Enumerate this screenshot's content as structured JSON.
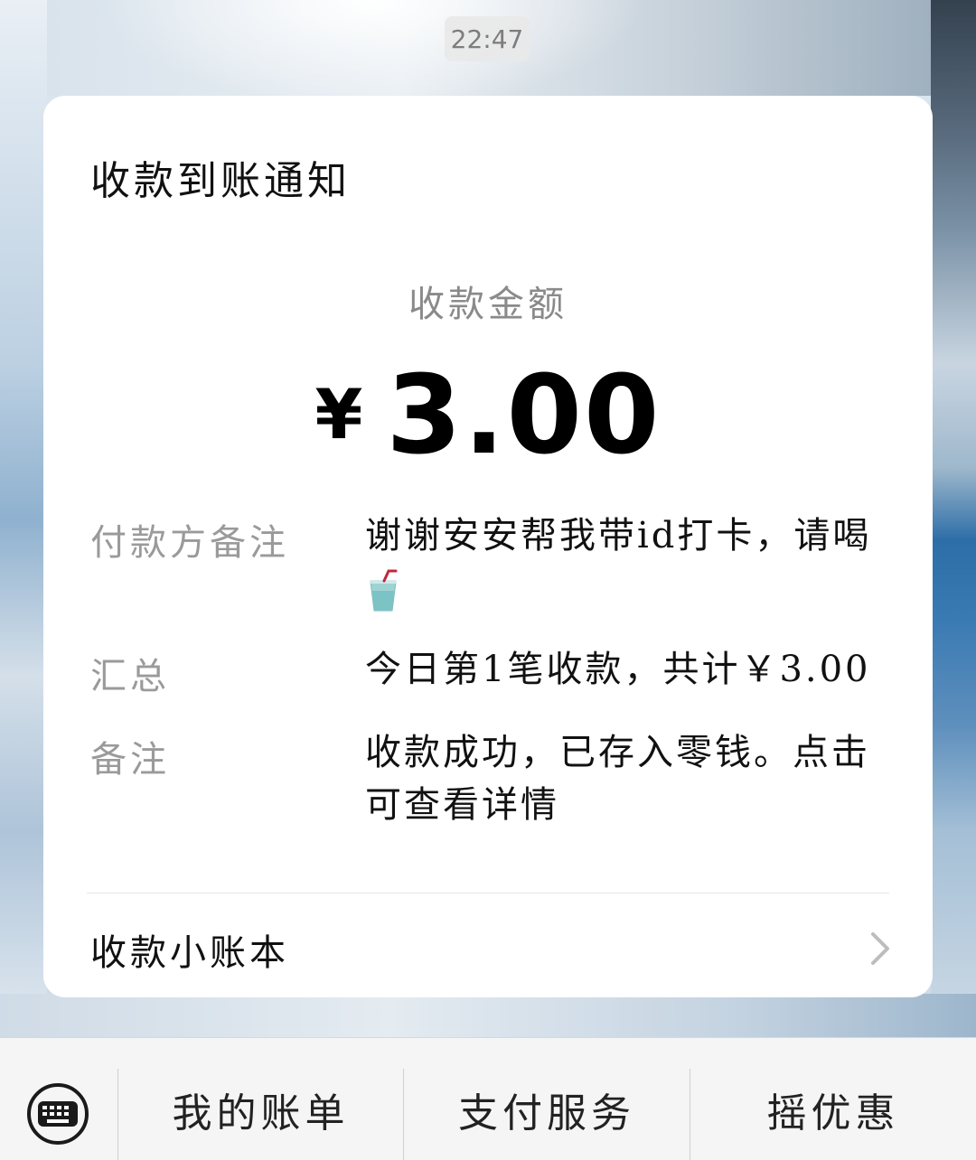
{
  "status": {
    "time": "22:47"
  },
  "notification": {
    "title": "收款到账通知",
    "amount_label": "收款金额",
    "currency_symbol": "¥",
    "amount": "3.00",
    "rows": [
      {
        "label": "付款方备注",
        "value": "谢谢安安帮我带id打卡，请喝",
        "icon": "cup-with-straw-icon"
      },
      {
        "label": "汇总",
        "value": "今日第1笔收款，共计￥3.00"
      },
      {
        "label": "备注",
        "value": "收款成功，已存入零钱。点击可查看详情"
      }
    ],
    "ledger_link": "收款小账本"
  },
  "bottom_menu": {
    "keyboard_icon": "keyboard-icon",
    "items": [
      "我的账单",
      "支付服务",
      "摇优惠"
    ]
  },
  "colors": {
    "card_bg": "#ffffff",
    "label_gray": "#9a9a9a",
    "text_dark": "#111111",
    "bar_bg": "#f5f5f5"
  }
}
